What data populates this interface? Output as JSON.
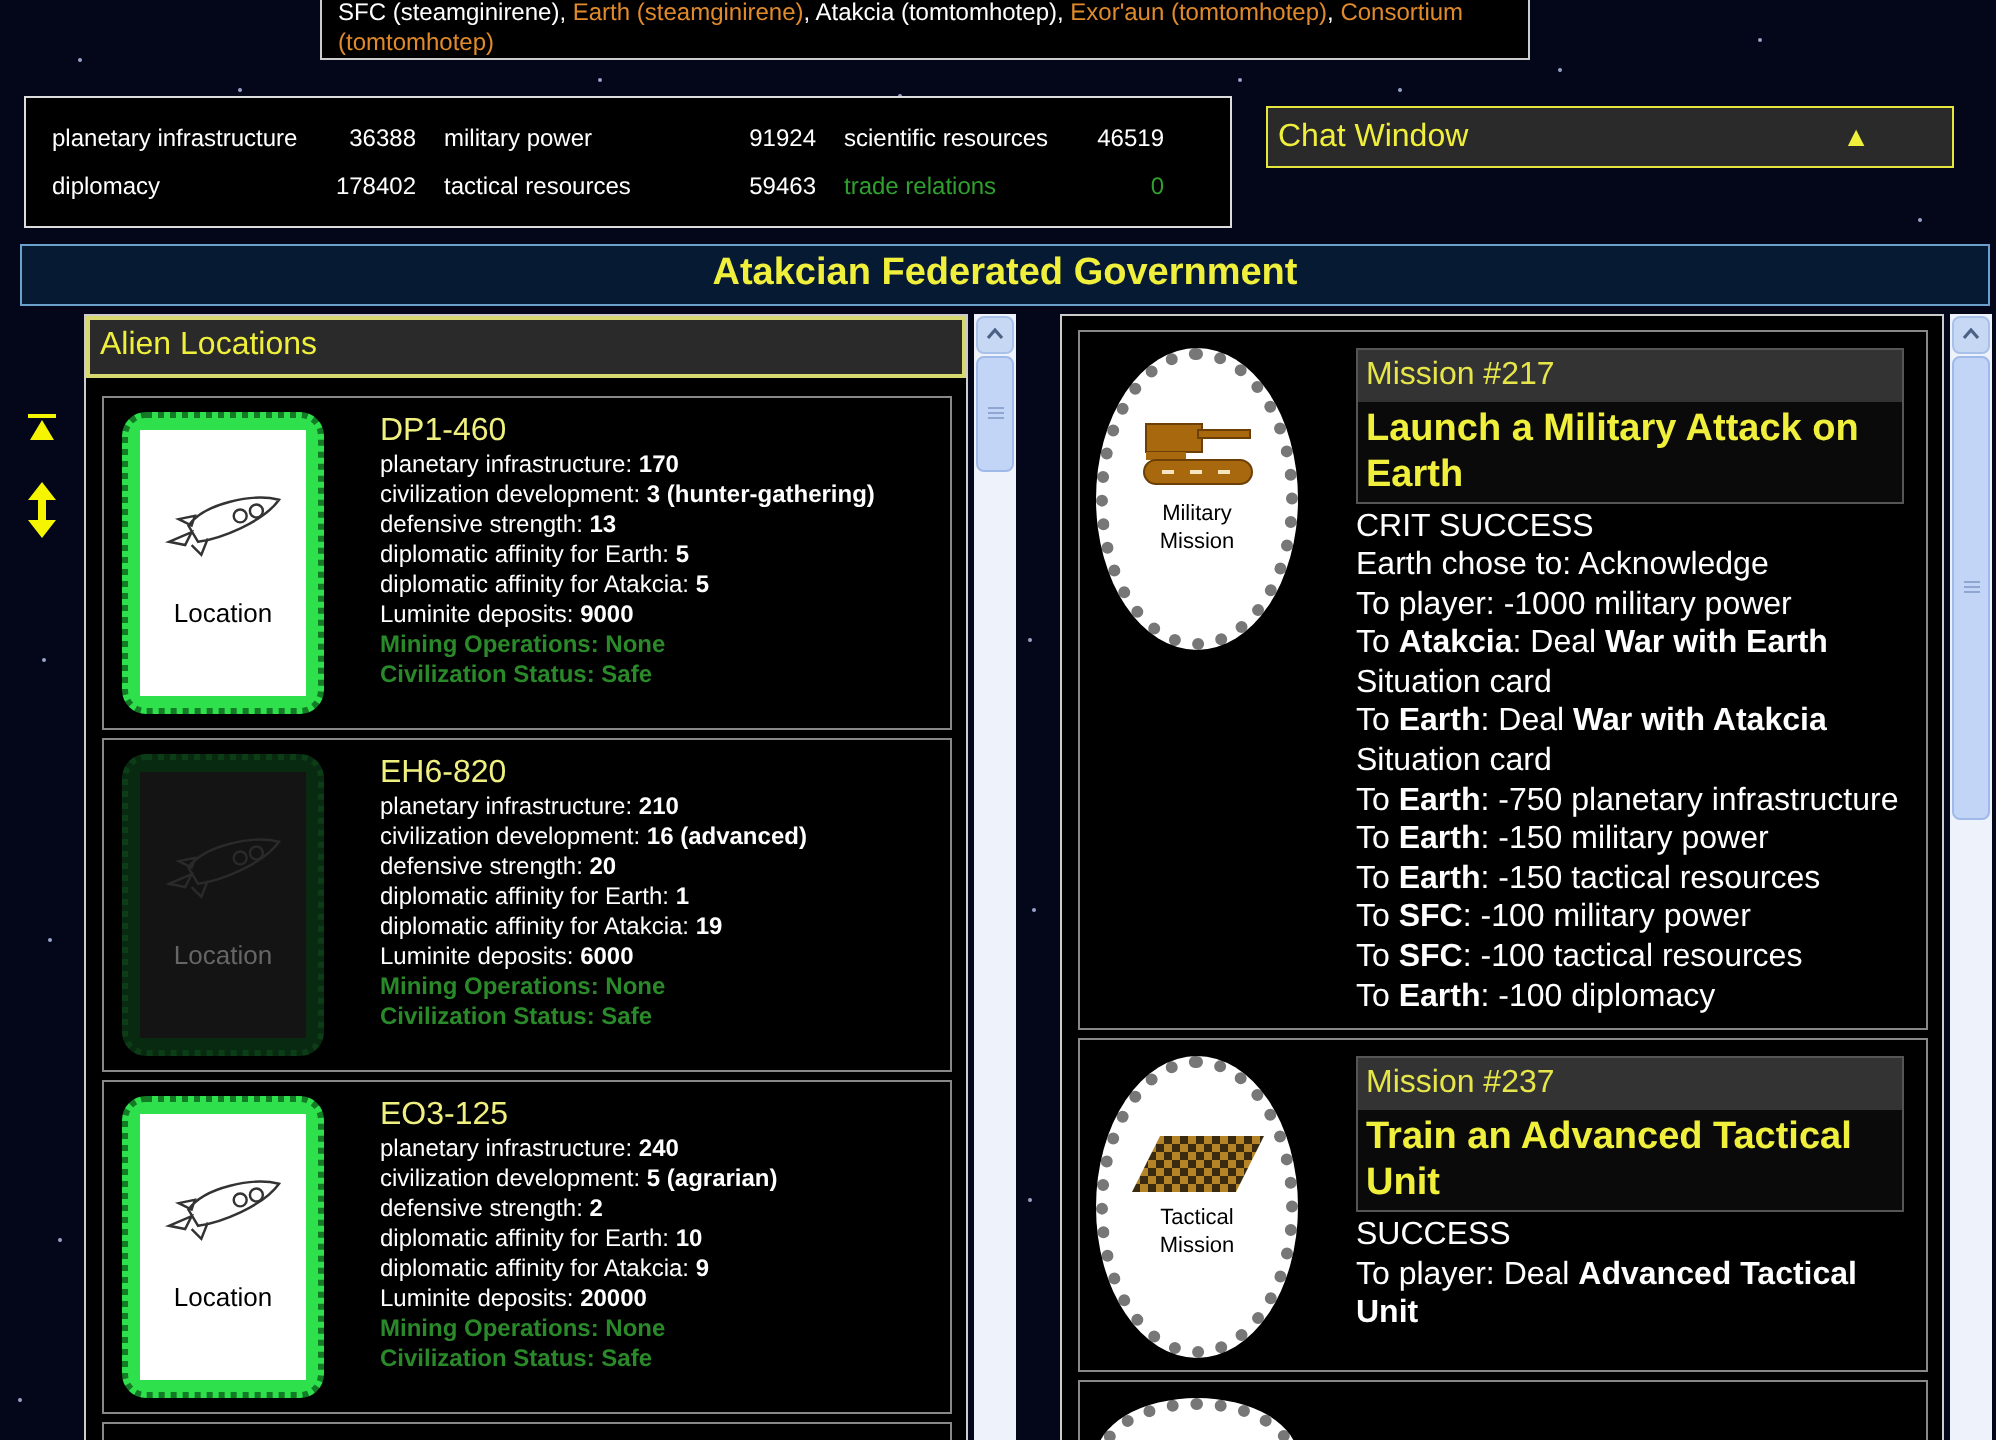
{
  "players_box": {
    "segments": [
      {
        "text": "SFC (steamginirene), ",
        "kind": "plain"
      },
      {
        "text": "Earth (steamginirene)",
        "kind": "faction"
      },
      {
        "text": ", Atakcia (tomtomhotep), ",
        "kind": "plain"
      },
      {
        "text": "Exor'aun (tomtomhotep)",
        "kind": "faction"
      },
      {
        "text": ", ",
        "kind": "plain"
      },
      {
        "text": "Consortium (tomtomhotep)",
        "kind": "faction"
      }
    ]
  },
  "stats": [
    {
      "label": "planetary infrastructure",
      "value": "36388",
      "kind": "resource"
    },
    {
      "label": "military power",
      "value": "91924",
      "kind": "resource"
    },
    {
      "label": "scientific resources",
      "value": "46519",
      "kind": "resource"
    },
    {
      "label": "diplomacy",
      "value": "178402",
      "kind": "resource"
    },
    {
      "label": "tactical resources",
      "value": "59463",
      "kind": "resource"
    },
    {
      "label": "trade relations",
      "value": "0",
      "kind": "relation"
    }
  ],
  "chat": {
    "title": "Chat Window",
    "toggle": "▲"
  },
  "title": "Atakcian Federated Government",
  "locations_panel": {
    "title": "Alien Locations"
  },
  "locations": [
    {
      "name": "DP1-460",
      "card_label": "Location",
      "dimmed": false,
      "stats": [
        {
          "label": "planetary infrastructure: ",
          "value": "170"
        },
        {
          "label": "civilization development: ",
          "value": "3 (hunter-gathering)"
        },
        {
          "label": "defensive strength: ",
          "value": "13"
        },
        {
          "label": "diplomatic affinity for Earth: ",
          "value": "5"
        },
        {
          "label": "diplomatic affinity for Atakcia: ",
          "value": "5"
        },
        {
          "label": "Luminite deposits: ",
          "value": "9000"
        }
      ],
      "status": [
        "Mining Operations: None",
        "Civilization Status: Safe"
      ]
    },
    {
      "name": "EH6-820",
      "card_label": "Location",
      "dimmed": true,
      "stats": [
        {
          "label": "planetary infrastructure: ",
          "value": "210"
        },
        {
          "label": "civilization development: ",
          "value": "16 (advanced)"
        },
        {
          "label": "defensive strength: ",
          "value": "20"
        },
        {
          "label": "diplomatic affinity for Earth: ",
          "value": "1"
        },
        {
          "label": "diplomatic affinity for Atakcia: ",
          "value": "19"
        },
        {
          "label": "Luminite deposits: ",
          "value": "6000"
        }
      ],
      "status": [
        "Mining Operations: None",
        "Civilization Status: Safe"
      ]
    },
    {
      "name": "EO3-125",
      "card_label": "Location",
      "dimmed": false,
      "stats": [
        {
          "label": "planetary infrastructure: ",
          "value": "240"
        },
        {
          "label": "civilization development: ",
          "value": "5 (agrarian)"
        },
        {
          "label": "defensive strength: ",
          "value": "2"
        },
        {
          "label": "diplomatic affinity for Earth: ",
          "value": "10"
        },
        {
          "label": "diplomatic affinity for Atakcia: ",
          "value": "9"
        },
        {
          "label": "Luminite deposits: ",
          "value": "20000"
        }
      ],
      "status": [
        "Mining Operations: None",
        "Civilization Status: Safe"
      ]
    }
  ],
  "missions": [
    {
      "kind": "military",
      "badge": "Military Mission",
      "number": "Mission #217",
      "title": "Launch a Military Attack on Earth",
      "outcome": "CRIT SUCCESS",
      "lines": [
        "Earth chose to: Acknowledge",
        "To player: -1000 military power",
        "To **Atakcia**: Deal **War with Earth** Situation card",
        "To **Earth**: Deal **War with Atakcia** Situation card",
        "To **Earth**: -750 planetary infrastructure",
        "To **Earth**: -150 military power",
        "To **Earth**: -150 tactical resources",
        "To **SFC**: -100 military power",
        "To **SFC**: -100 tactical resources",
        "To **Earth**: -100 diplomacy"
      ]
    },
    {
      "kind": "tactical",
      "badge": "Tactical Mission",
      "number": "Mission #237",
      "title": "Train an Advanced Tactical Unit",
      "outcome": "SUCCESS",
      "lines": [
        "To player: Deal **Advanced Tactical Unit**"
      ]
    }
  ]
}
